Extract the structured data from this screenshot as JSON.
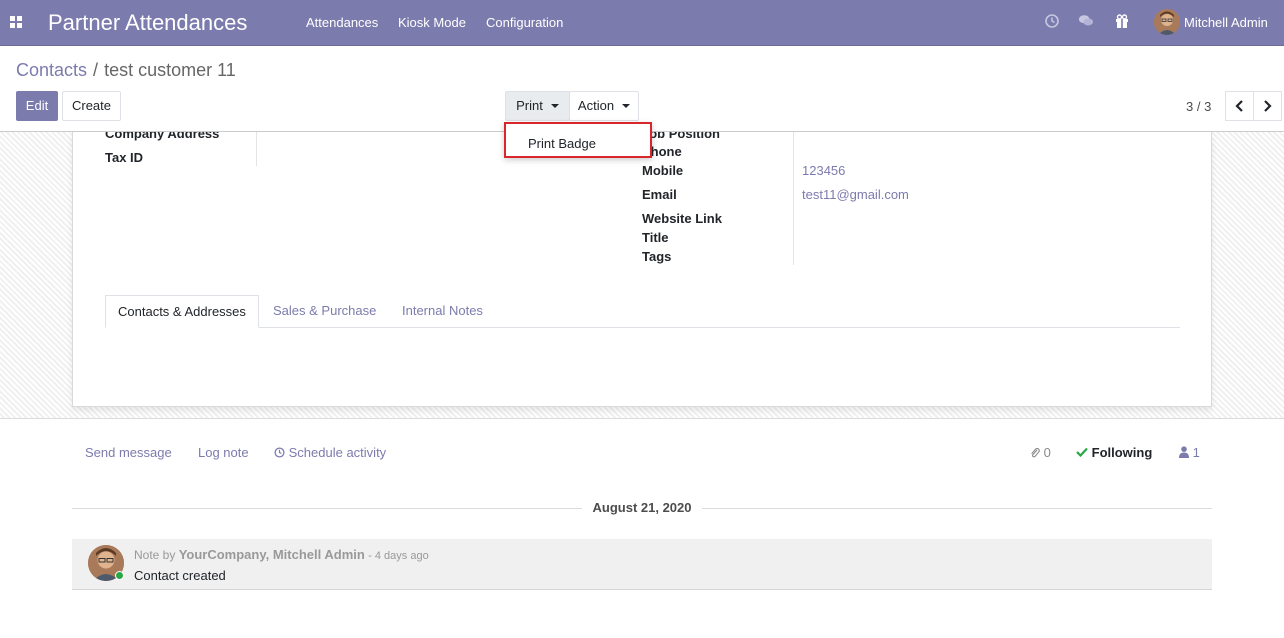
{
  "app": {
    "title": "Partner Attendances",
    "menu": [
      "Attendances",
      "Kiosk Mode",
      "Configuration"
    ],
    "user_name": "Mitchell Admin",
    "accent": "#7c7bad"
  },
  "breadcrumb": {
    "parent": "Contacts",
    "separator": "/",
    "current": "test customer 11"
  },
  "toolbar": {
    "edit_label": "Edit",
    "create_label": "Create",
    "print_label": "Print",
    "action_label": "Action",
    "pager": "3 / 3"
  },
  "print_menu": {
    "items": [
      "Print Badge"
    ],
    "highlight_color": "#d9262d"
  },
  "form": {
    "left_labels": [
      "Company Address",
      "Tax ID"
    ],
    "right_labels": [
      "Job Position",
      "Phone",
      "Mobile",
      "Email",
      "Website Link",
      "Title",
      "Tags"
    ],
    "mobile": "123456",
    "email": "test11@gmail.com",
    "tabs": [
      "Contacts & Addresses",
      "Sales & Purchase",
      "Internal Notes"
    ]
  },
  "chatter": {
    "send_message": "Send message",
    "log_note": "Log note",
    "schedule_activity": "Schedule activity",
    "attachments_count": "0",
    "following_label": "Following",
    "followers_count": "1",
    "date_separator": "August 21, 2020",
    "message": {
      "prefix": "Note by",
      "author": "YourCompany, Mitchell Admin",
      "date": "- 4 days ago",
      "body": "Contact created"
    }
  }
}
